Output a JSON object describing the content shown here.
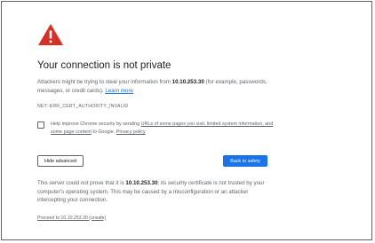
{
  "page": {
    "title": "Your connection is not private",
    "lead_prefix": "Attackers might be trying to steal your information from ",
    "host": "10.10.253.30",
    "lead_suffix": " (for example, passwords, messages, or credit cards). ",
    "learn_more": "Learn more",
    "error_code": "NET::ERR_CERT_AUTHORITY_INVALID",
    "colors": {
      "warning": "#d93025",
      "link": "#1a73e8",
      "primary_button": "#1a73e8"
    }
  },
  "safe_browsing": {
    "checked": false,
    "text_1": "Help improve Chrome security by sending ",
    "link_1": "URLs of some pages you visit, limited system information, and some page content",
    "text_2": " to Google. ",
    "privacy_link": "Privacy policy"
  },
  "buttons": {
    "advanced": "Hide advanced",
    "back": "Back to safety"
  },
  "advanced": {
    "text_prefix": "This server could not prove that it is ",
    "host": "10.10.253.30",
    "text_suffix": "; its security certificate is not trusted by your computer's operating system. This may be caused by a misconfiguration or an attacker intercepting your connection.",
    "proceed_link": "Proceed to 10.10.253.30 (unsafe)"
  },
  "icons": {
    "warning": "warning-triangle-icon"
  }
}
